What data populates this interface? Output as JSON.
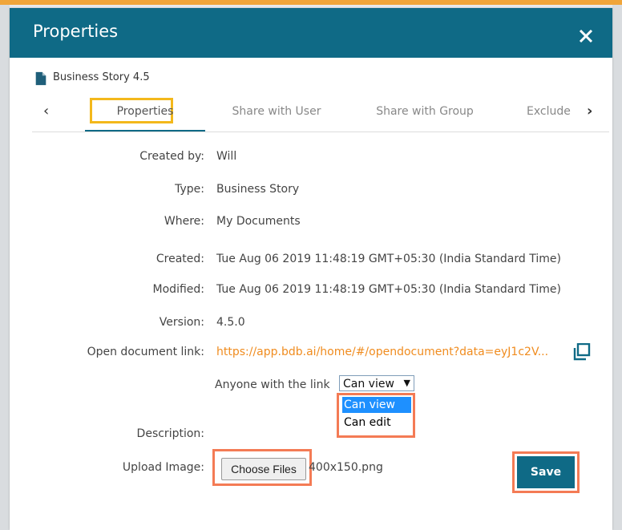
{
  "dialog": {
    "title": "Properties",
    "document_name": "Business Story 4.5"
  },
  "tabs": [
    {
      "label": "Properties",
      "active": true
    },
    {
      "label": "Share with User",
      "active": false
    },
    {
      "label": "Share with Group",
      "active": false
    },
    {
      "label": "Exclude",
      "active": false
    }
  ],
  "properties": {
    "created_by": {
      "label": "Created by:",
      "value": "Will"
    },
    "type": {
      "label": "Type:",
      "value": "Business Story"
    },
    "where": {
      "label": "Where:",
      "value": "My Documents"
    },
    "created": {
      "label": "Created:",
      "value": "Tue Aug 06 2019 11:48:19 GMT+05:30 (India Standard Time)"
    },
    "modified": {
      "label": "Modified:",
      "value": "Tue Aug 06 2019 11:48:19 GMT+05:30 (India Standard Time)"
    },
    "version": {
      "label": "Version:",
      "value": "4.5.0"
    },
    "open_link": {
      "label": "Open document link:",
      "value": "https://app.bdb.ai/home/#/opendocument?data=eyJ1c2V..."
    },
    "description": {
      "label": "Description:"
    },
    "upload_image": {
      "label": "Upload Image:",
      "button_label": "Choose Files",
      "file_name": "400x150.png"
    }
  },
  "link_permission": {
    "label": "Anyone with the link",
    "selected": "Can view",
    "options": [
      "Can view",
      "Can edit"
    ]
  },
  "actions": {
    "save_label": "Save"
  },
  "colors": {
    "header": "#0f6a86",
    "link": "#f08c1f",
    "tab_highlight": "#f3b81b",
    "annotation_box": "#f47b55",
    "option_selected": "#1e90ff"
  }
}
